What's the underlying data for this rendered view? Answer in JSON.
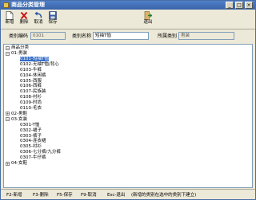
{
  "window": {
    "title": "商品分类管理"
  },
  "toolbar": {
    "add": "新增",
    "delete": "删除",
    "cancel": "取消",
    "save": "保存",
    "exit": "退出"
  },
  "form": {
    "code_label": "类别编码",
    "code_value": "0101",
    "name_label": "类别名称",
    "name_value": "短袖T恤",
    "parent_label": "所属类别",
    "parent_value": "男装"
  },
  "tree": {
    "root": "商品分类",
    "nodes": [
      "01-男装",
      "0101-短袖T恤",
      "0102-无袖T恤/背心",
      "0103-牛裤",
      "0104-休闲裤",
      "0105-西服",
      "0106-西裤",
      "0107-民族装",
      "0108-衬衫",
      "0109-时尚",
      "0110-毛衣",
      "02-男鞋",
      "03-女装",
      "0301-T恤",
      "0302-裙子",
      "0303-裤子",
      "0304-连衣裙",
      "0305-衬衫",
      "0306-七分裤/九分裤",
      "0307-牛仔裤",
      "04-女鞋"
    ]
  },
  "status": {
    "f2": "F2-新增",
    "f3": "F3-删除",
    "f5": "F5-保存",
    "f9": "F9-取消",
    "esc": "Esc-退出",
    "hint": "(新增的类别在选中的类别下建立)"
  }
}
